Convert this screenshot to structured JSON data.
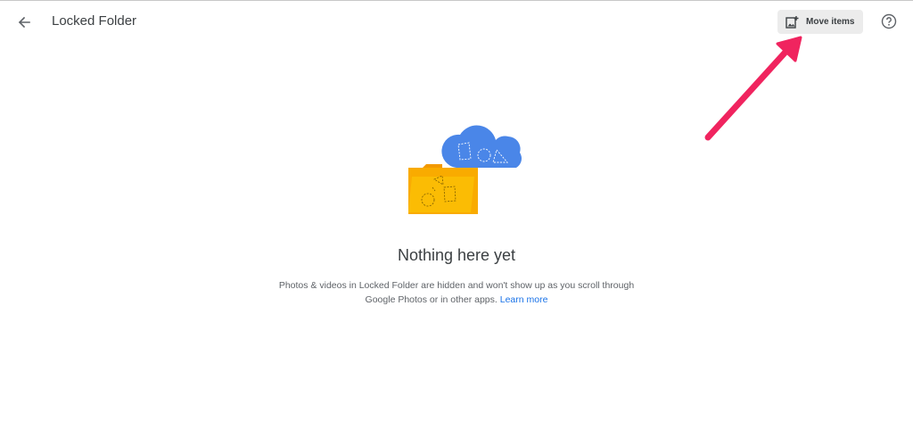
{
  "header": {
    "title": "Locked Folder",
    "back_icon": "arrow-back-icon",
    "move_button_label": "Move items",
    "move_icon": "add-photo-icon",
    "help_icon": "help-circle-icon"
  },
  "empty_state": {
    "title": "Nothing here yet",
    "description": "Photos & videos in Locked Folder are hidden and won't show up as you scroll through Google Photos or in other apps.",
    "learn_more_label": "Learn more",
    "illustration": "folder-cloud-illustration"
  },
  "colors": {
    "accent": "#1a73e8",
    "annotation_arrow": "#f0245f",
    "folder": "#fbbc04",
    "cloud": "#4285f4"
  }
}
